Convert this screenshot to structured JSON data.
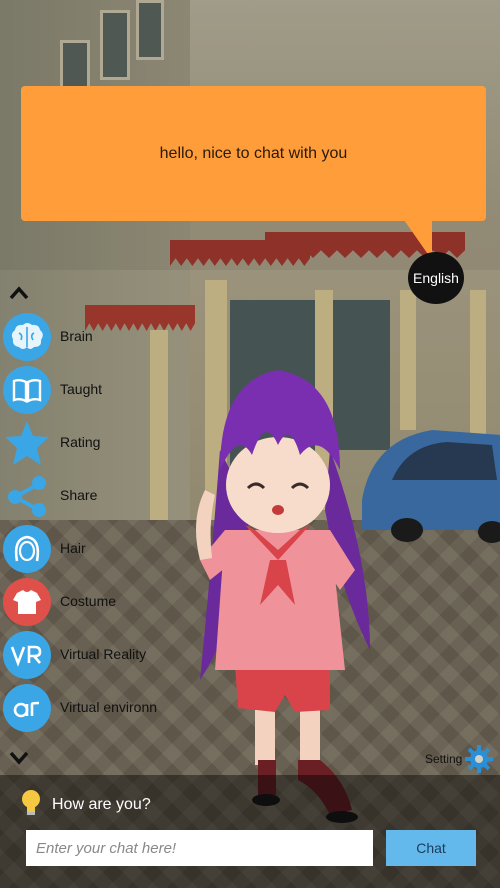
{
  "speech": {
    "text": "hello, nice to chat with you"
  },
  "language_button": {
    "label": "English"
  },
  "sidebar": {
    "items": [
      {
        "label": "Brain",
        "icon": "brain-icon",
        "color": "#3aa6e6"
      },
      {
        "label": "Taught",
        "icon": "book-icon",
        "color": "#3aa6e6"
      },
      {
        "label": "Rating",
        "icon": "star-icon",
        "color": "#3aa6e6"
      },
      {
        "label": "Share",
        "icon": "share-icon",
        "color": "#3aa6e6"
      },
      {
        "label": "Hair",
        "icon": "hair-icon",
        "color": "#3aa6e6"
      },
      {
        "label": "Costume",
        "icon": "tshirt-icon",
        "color": "#e0504a"
      },
      {
        "label": "Virtual Reality",
        "icon": "vr-icon",
        "color": "#3aa6e6"
      },
      {
        "label": "Virtual environn",
        "icon": "ar-icon",
        "color": "#3aa6e6"
      }
    ]
  },
  "setting": {
    "label": "Setting"
  },
  "suggestion": {
    "text": "How are you?"
  },
  "chat": {
    "placeholder": "Enter your chat here!",
    "button_label": "Chat"
  }
}
